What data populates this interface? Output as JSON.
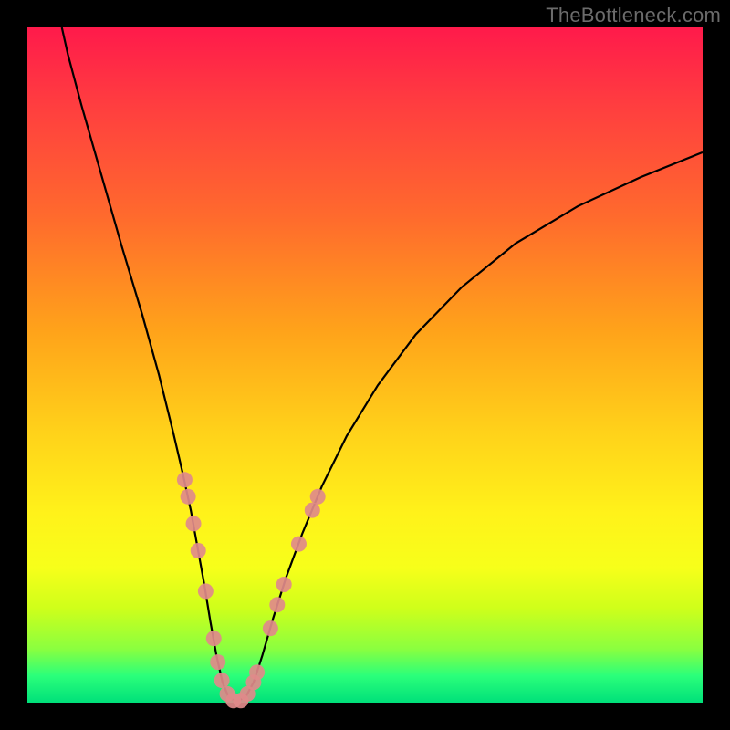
{
  "watermark": "TheBottleneck.com",
  "chart_data": {
    "type": "line",
    "title": "",
    "xlabel": "",
    "ylabel": "",
    "xlim": [
      0,
      100
    ],
    "ylim": [
      0,
      100
    ],
    "grid": false,
    "legend": false,
    "curve_points": [
      {
        "x": 5.1,
        "y": 100.0
      },
      {
        "x": 6.0,
        "y": 96.0
      },
      {
        "x": 8.0,
        "y": 88.5
      },
      {
        "x": 11.0,
        "y": 78.0
      },
      {
        "x": 14.0,
        "y": 67.5
      },
      {
        "x": 17.0,
        "y": 57.5
      },
      {
        "x": 19.5,
        "y": 48.5
      },
      {
        "x": 21.6,
        "y": 40.0
      },
      {
        "x": 23.0,
        "y": 34.0
      },
      {
        "x": 24.2,
        "y": 28.5
      },
      {
        "x": 25.2,
        "y": 23.0
      },
      {
        "x": 26.2,
        "y": 17.5
      },
      {
        "x": 27.1,
        "y": 12.0
      },
      {
        "x": 28.0,
        "y": 7.0
      },
      {
        "x": 28.9,
        "y": 3.0
      },
      {
        "x": 29.8,
        "y": 0.8
      },
      {
        "x": 31.0,
        "y": 0.2
      },
      {
        "x": 32.3,
        "y": 0.8
      },
      {
        "x": 33.5,
        "y": 3.0
      },
      {
        "x": 34.8,
        "y": 7.0
      },
      {
        "x": 36.4,
        "y": 12.5
      },
      {
        "x": 38.3,
        "y": 18.5
      },
      {
        "x": 40.7,
        "y": 25.0
      },
      {
        "x": 43.6,
        "y": 32.0
      },
      {
        "x": 47.3,
        "y": 39.5
      },
      {
        "x": 51.9,
        "y": 47.0
      },
      {
        "x": 57.5,
        "y": 54.5
      },
      {
        "x": 64.3,
        "y": 61.5
      },
      {
        "x": 72.3,
        "y": 68.0
      },
      {
        "x": 81.5,
        "y": 73.5
      },
      {
        "x": 90.8,
        "y": 77.8
      },
      {
        "x": 100.0,
        "y": 81.5
      }
    ],
    "markers": [
      {
        "x": 23.3,
        "y": 33.0
      },
      {
        "x": 23.8,
        "y": 30.5
      },
      {
        "x": 24.6,
        "y": 26.5
      },
      {
        "x": 25.3,
        "y": 22.5
      },
      {
        "x": 26.4,
        "y": 16.5
      },
      {
        "x": 27.6,
        "y": 9.5
      },
      {
        "x": 28.2,
        "y": 6.0
      },
      {
        "x": 28.8,
        "y": 3.3
      },
      {
        "x": 29.6,
        "y": 1.3
      },
      {
        "x": 30.5,
        "y": 0.3
      },
      {
        "x": 31.6,
        "y": 0.3
      },
      {
        "x": 32.6,
        "y": 1.3
      },
      {
        "x": 33.5,
        "y": 3.0
      },
      {
        "x": 34.0,
        "y": 4.5
      },
      {
        "x": 36.0,
        "y": 11.0
      },
      {
        "x": 37.0,
        "y": 14.5
      },
      {
        "x": 38.0,
        "y": 17.5
      },
      {
        "x": 40.2,
        "y": 23.5
      },
      {
        "x": 42.2,
        "y": 28.5
      },
      {
        "x": 43.0,
        "y": 30.5
      }
    ],
    "marker_radius_px": 8.5,
    "gradient_colors": {
      "top": "#ff1a4b",
      "mid": "#fff21a",
      "bottom": "#00e07a"
    },
    "background": "#000000"
  }
}
